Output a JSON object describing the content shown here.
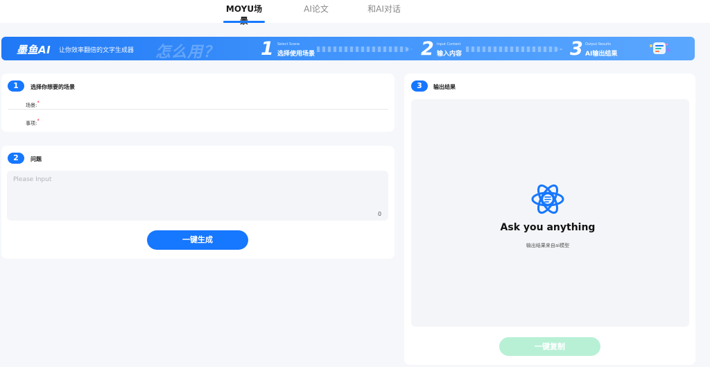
{
  "nav": {
    "tabs": [
      {
        "label": "MOYU场景",
        "active": true
      },
      {
        "label": "AI论文",
        "active": false
      },
      {
        "label": "和AI对话",
        "active": false
      }
    ]
  },
  "banner": {
    "logo": "墨鱼AI",
    "slogan": "让你效率翻倍的文字生成器",
    "how": "怎么用？",
    "steps": [
      {
        "num": "1",
        "en": "Select Scene",
        "cn": "选择使用场景"
      },
      {
        "num": "2",
        "en": "Input Content",
        "cn": "输入内容"
      },
      {
        "num": "3",
        "en": "Output Results",
        "cn": "AI输出结果"
      }
    ],
    "deco_icon": "ai-robot-icon"
  },
  "scene_card": {
    "badge": "1",
    "title": "选择你想要的场景",
    "fields": [
      {
        "label": "场景:",
        "required_mark": "*"
      },
      {
        "label": "事项:",
        "required_mark": "*"
      }
    ]
  },
  "question_card": {
    "badge": "2",
    "title": "问题",
    "input_placeholder": "Please Input",
    "input_value": "",
    "counter": "0",
    "generate_button": "一键生成"
  },
  "output_card": {
    "badge": "3",
    "title": "输出结果",
    "icon": "atom-icon",
    "headline": "Ask you anything",
    "subtitle": "输出结果来自ai模型",
    "copy_button": "一键复制"
  },
  "colors": {
    "primary": "#1677ff",
    "copy_button_disabled": "#b8f0d6",
    "page_bg": "#f5f7fb",
    "required": "#f5222d"
  }
}
